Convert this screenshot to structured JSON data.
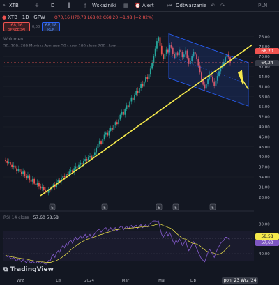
{
  "toolbar": {
    "symbol": "XTB",
    "timeframe": "D",
    "indicators_label": "Wskaźniki",
    "alert_label": "Alert",
    "replay_label": "Odtwarzanie",
    "currency": "PLN"
  },
  "legend": {
    "title": "XTB · 1D · GPW",
    "ohlc": "O70,16  H70,78  L68,02  C68,20  −1,98 (−2,82%)",
    "sell_price": "68,16",
    "sell_label": "SPRZEDAJ",
    "spread": "0,00",
    "buy_price": "68,18",
    "buy_label": "KUP",
    "volume_label": "Wolumen",
    "ma_label": "50, 100, 200 Moving Average  50  close  100  close  200  close",
    "rsi_label": "RSI  14  close",
    "rsi_values": "57,60   58,58"
  },
  "price_tags": {
    "current": "68,20",
    "countdown": "64,24",
    "rsi_a": "58,58",
    "rsi_b": "57,60"
  },
  "events": [
    "E",
    "E",
    "E",
    "E",
    "E"
  ],
  "footer": {
    "date_label": "pon. 23 Wrz '24",
    "brand": "TradingView"
  },
  "colors": {
    "up": "#26a69a",
    "down": "#ef5350",
    "trendline": "#f5e94b",
    "channel": "#2962ff",
    "rsi_line": "#7e57c2",
    "ma": "#f5e94b"
  },
  "chart_data": {
    "type": "candlestick",
    "x_ticks": [
      "Wrz",
      "Lis",
      "2024",
      "Mar",
      "Maj",
      "Lip",
      "Wrz"
    ],
    "y_ticks": [
      76,
      73,
      70,
      67,
      64,
      61,
      58,
      55,
      52,
      49,
      46,
      43,
      40,
      37,
      34,
      31,
      28
    ],
    "ylim": [
      26.5,
      79
    ],
    "rsi_ticks": [
      80,
      60,
      40
    ],
    "rsi_ylim": [
      25,
      85
    ],
    "candles_close": [
      38.8,
      38.2,
      38.5,
      37.6,
      37.0,
      37.4,
      36.6,
      35.8,
      36.4,
      35.5,
      34.9,
      35.6,
      34.2,
      33.8,
      34.5,
      33.2,
      32.6,
      33.4,
      32.0,
      31.6,
      32.3,
      31.2,
      30.6,
      31.0,
      30.2,
      29.6,
      29.3,
      30.4,
      30.0,
      31.2,
      31.8,
      31.0,
      32.4,
      33.0,
      32.6,
      33.8,
      34.4,
      33.9,
      35.0,
      34.6,
      35.6,
      36.0,
      35.4,
      36.6,
      37.2,
      36.8,
      37.6,
      38.2,
      37.8,
      38.8,
      39.4,
      38.9,
      39.8,
      40.2,
      39.6,
      40.6,
      41.4,
      42.6,
      43.8,
      44.6,
      44.0,
      45.4,
      46.6,
      47.2,
      46.4,
      47.8,
      48.8,
      48.2,
      49.6,
      50.4,
      49.8,
      51.2,
      52.6,
      53.4,
      52.6,
      54.2,
      55.4,
      54.8,
      56.6,
      57.8,
      57.0,
      58.6,
      59.8,
      59.0,
      60.6,
      61.8,
      61.0,
      62.6,
      63.8,
      63.2,
      64.8,
      66.4,
      68.0,
      70.2,
      72.4,
      74.6,
      75.8,
      73.2,
      70.6,
      69.4,
      70.8,
      72.0,
      71.2,
      73.4,
      72.6,
      70.8,
      69.6,
      71.2,
      70.4,
      72.0,
      71.4,
      69.8,
      70.6,
      71.8,
      69.6,
      67.8,
      68.6,
      70.2,
      71.4,
      70.6,
      69.2,
      67.4,
      65.2,
      63.0,
      61.6,
      60.4,
      61.8,
      63.4,
      64.6,
      63.8,
      62.6,
      61.2,
      62.8,
      64.2,
      65.6,
      66.8,
      67.6,
      68.4,
      69.8,
      70.6,
      69.8,
      68.2
    ],
    "rsi_values": [
      38,
      36,
      37,
      34,
      33,
      35,
      32,
      30,
      33,
      31,
      29,
      32,
      30,
      28,
      31,
      29,
      27,
      30,
      28,
      27,
      30,
      28,
      27,
      29,
      27,
      26,
      26,
      31,
      30,
      36,
      39,
      35,
      41,
      44,
      42,
      48,
      51,
      48,
      54,
      51,
      56,
      58,
      54,
      59,
      62,
      58,
      61,
      64,
      60,
      63,
      66,
      62,
      64,
      66,
      61,
      64,
      67,
      70,
      72,
      73,
      69,
      72,
      74,
      75,
      70,
      73,
      75,
      71,
      74,
      75,
      71,
      74,
      76,
      77,
      72,
      75,
      77,
      73,
      76,
      78,
      74,
      77,
      78,
      74,
      77,
      79,
      75,
      77,
      79,
      76,
      79,
      81,
      83,
      84,
      84,
      83,
      84,
      74,
      66,
      62,
      66,
      69,
      64,
      68,
      64,
      57,
      53,
      58,
      55,
      60,
      57,
      51,
      54,
      58,
      50,
      44,
      47,
      52,
      56,
      52,
      47,
      42,
      37,
      33,
      31,
      29,
      35,
      41,
      46,
      43,
      39,
      35,
      41,
      46,
      50,
      54,
      56,
      58,
      62,
      62,
      60,
      58
    ]
  }
}
